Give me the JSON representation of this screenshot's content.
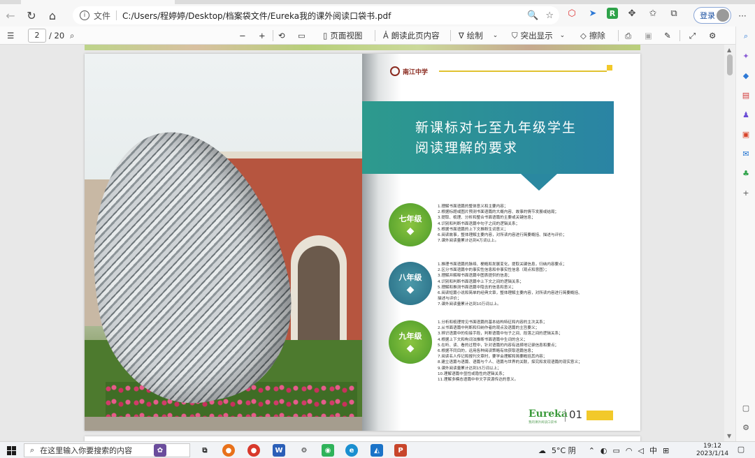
{
  "browser": {
    "url_scheme": "文件",
    "url": "C:/Users/程婷婷/Desktop/档案袋文件/Eureka我的课外阅读口袋书.pdf",
    "login_label": "登录",
    "extension_letter": "R"
  },
  "pdf_toolbar": {
    "current_page": "2",
    "total_pages": "/ 20",
    "page_view_label": "页面视图",
    "read_aloud_label": "朗读此页内容",
    "draw_label": "绘制",
    "highlight_label": "突出显示",
    "erase_label": "擦除"
  },
  "document": {
    "school_name": "南江中学",
    "banner_line1": "新课标对七至九年级学生",
    "banner_line2": "阅读理解的要求",
    "grades": [
      {
        "label": "七年级",
        "requirements": [
          "1.理解书面语篇的整体意义和主要内容；",
          "2.根据标题或图片预测书面语篇的大概内容、故事的情节发展或结局；",
          "3.提取、梳理、分析和整合书面语篇的主要或关键信息；",
          "4.识别和判断书面语篇中句子之间的逻辑关系；",
          "5.根据书面语篇的上下文推断生词意义；",
          "6.阅读故事，整体理解主要内容，对所读内容进行简要概括、描述与评价；",
          "7.课外阅读量累计达到4万词以上。"
        ]
      },
      {
        "label": "八年级",
        "requirements": [
          "1.推理书面语篇的脉络、梗概和发展变化，提取关键信息，归纳内容要点；",
          "2.区分书面语篇中的事实性信息和非事实性信息（观点和意图）；",
          "3.理解并解释书面语篇中图表提供的信息；",
          "4.识别和判断书面语篇中上下文之间的逻辑关系；",
          "5.理解和推测书面语篇中隐含的信息和意义；",
          "6.阅读短篇小说和简单的经典文章，整体理解主要内容，对所读内容进行简要概括、",
          "   描述与评价；",
          "7.课外阅读量累计达到10万词以上。"
        ]
      },
      {
        "label": "九年级",
        "requirements": [
          "1.分析和梳理常见书面语篇的基本结构特征和内容的主次关系；",
          "2.从书面语篇中判断和归纳作者的观点及语篇的主旨要义；",
          "3.辨识语篇中的衔接手段，判断语篇中句子之间、段落之间的逻辑关系；",
          "4.根据上下文和构词法推断书面语篇中生词的含义；",
          "5.在听、读、看的过程中，针对语篇的内容有选择地记录信息和要点；",
          "6.根据不同目的，运用各种阅读策略有效获取语篇信息；",
          "7.阅读名人传记和报刊文章时，要学会理解和简要概括其内容；",
          "8.建立语篇与语篇、语篇与个人、语篇与世界的关联，探究和发现语篇的现实意义；",
          "9.课外阅读量累计达到15万词以上；",
          "10.理解语篇中显性或隐性的逻辑关系；",
          "11.理解多模态语篇中非文字资源传达的意义。"
        ]
      }
    ],
    "footer_brand": "Eureka",
    "footer_sub": "我的课外阅读口袋书",
    "page_number": "01"
  },
  "taskbar": {
    "search_placeholder": "在这里输入你要搜索的内容",
    "weather": "5°C 阴",
    "ime": "中",
    "time": "19:12",
    "date": "2023/1/14"
  }
}
